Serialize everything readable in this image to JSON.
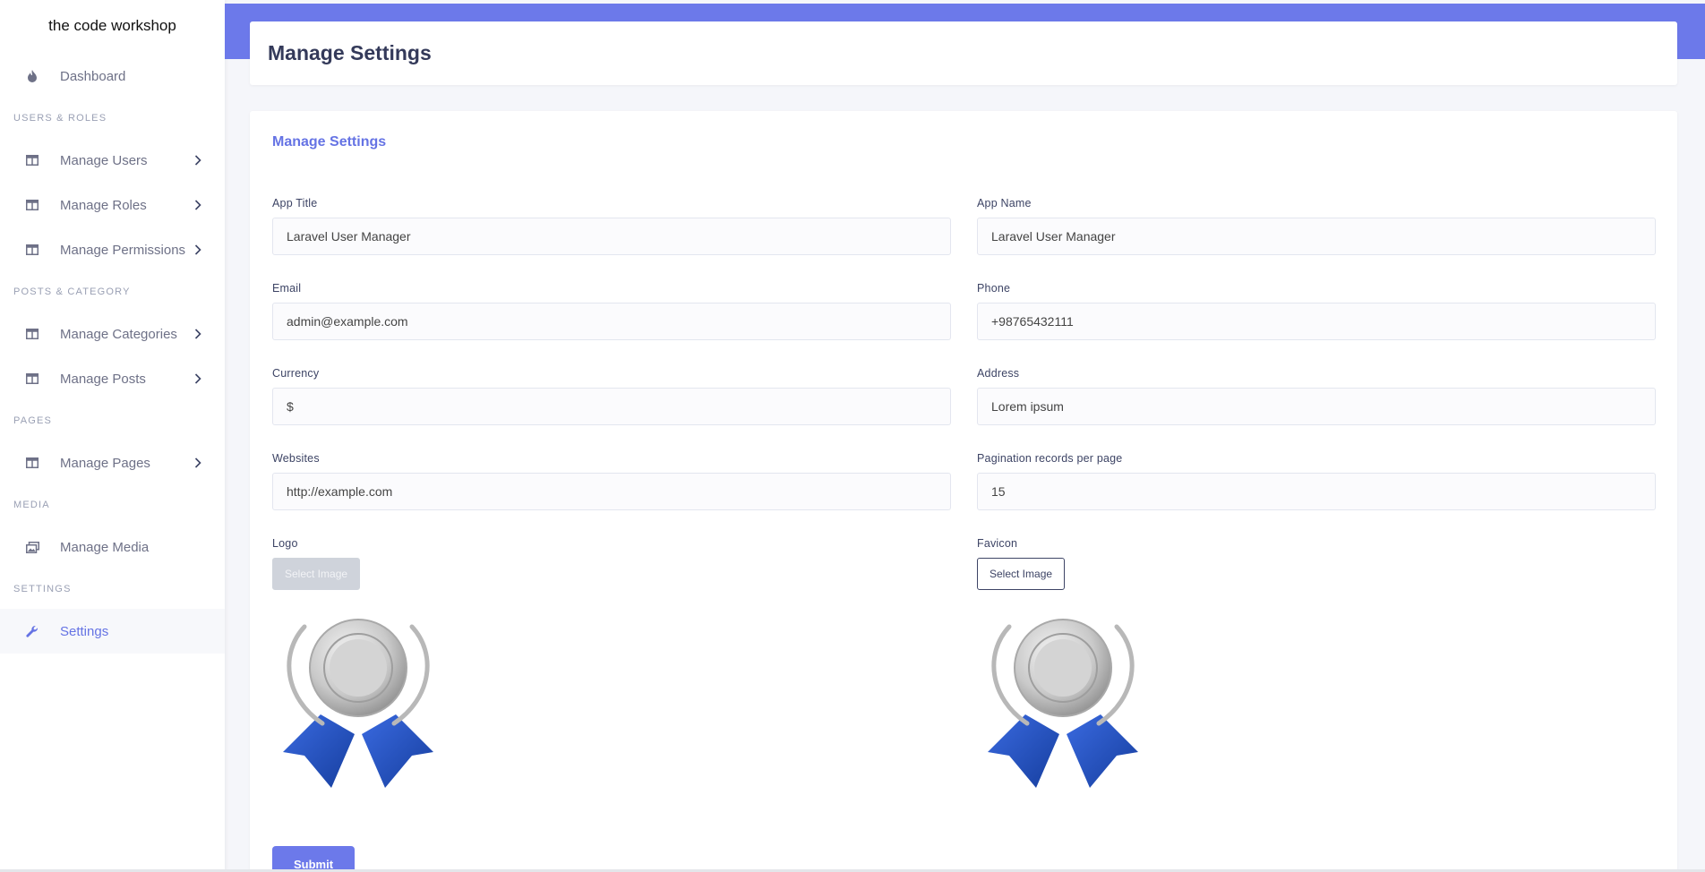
{
  "brand": "the code workshop",
  "sidebar": {
    "dashboard": "Dashboard",
    "sections": {
      "users_roles": "USERS & ROLES",
      "posts_category": "POSTS & CATEGORY",
      "pages": "PAGES",
      "media": "MEDIA",
      "settings": "SETTINGS"
    },
    "items": {
      "manage_users": "Manage Users",
      "manage_roles": "Manage Roles",
      "manage_permissions": "Manage Permissions",
      "manage_categories": "Manage Categories",
      "manage_posts": "Manage Posts",
      "manage_pages": "Manage Pages",
      "manage_media": "Manage Media",
      "settings": "Settings"
    },
    "active": "settings"
  },
  "header": {
    "title": "Manage Settings"
  },
  "form": {
    "title": "Manage Settings",
    "app_title": {
      "label": "App Title",
      "value": "Laravel User Manager"
    },
    "app_name": {
      "label": "App Name",
      "value": "Laravel User Manager"
    },
    "email": {
      "label": "Email",
      "value": "admin@example.com"
    },
    "phone": {
      "label": "Phone",
      "value": "+98765432111"
    },
    "currency": {
      "label": "Currency",
      "value": "$"
    },
    "address": {
      "label": "Address",
      "value": "Lorem ipsum"
    },
    "websites": {
      "label": "Websites",
      "value": "http://example.com"
    },
    "pagination": {
      "label": "Pagination records per page",
      "value": "15"
    },
    "logo": {
      "label": "Logo",
      "button": "Select Image",
      "icon": "silver-medal-icon"
    },
    "favicon": {
      "label": "Favicon",
      "button": "Select Image",
      "icon": "silver-medal-icon"
    },
    "submit": "Submit"
  },
  "colors": {
    "accent": "#6c79ea",
    "active_text": "#6573e4",
    "ribbon": "#1f4fbf",
    "medal": "#c8c8c8"
  }
}
